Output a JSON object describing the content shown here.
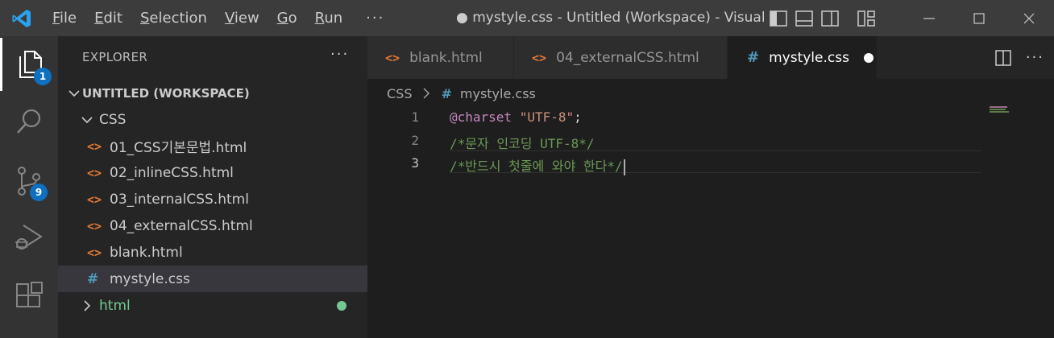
{
  "titlebar": {
    "menu": [
      {
        "label": "File",
        "u": "F",
        "rest": "ile"
      },
      {
        "label": "Edit",
        "u": "E",
        "rest": "dit"
      },
      {
        "label": "Selection",
        "u": "S",
        "rest": "election"
      },
      {
        "label": "View",
        "u": "V",
        "rest": "iew"
      },
      {
        "label": "Go",
        "u": "G",
        "rest": "o"
      },
      {
        "label": "Run",
        "u": "R",
        "rest": "un"
      }
    ],
    "more": "···",
    "title": "● mystyle.css - Untitled (Workspace) - Visual St..."
  },
  "activity": {
    "explorer_badge": "1",
    "scm_badge": "9"
  },
  "sidebar": {
    "header": "EXPLORER",
    "more": "···",
    "workspace": "UNTITLED (WORKSPACE)",
    "folder": "CSS",
    "files": [
      {
        "name": "01_CSS기본문법.html",
        "type": "html",
        "icon": "<>"
      },
      {
        "name": "02_inlineCSS.html",
        "type": "html",
        "icon": "<>"
      },
      {
        "name": "03_internalCSS.html",
        "type": "html",
        "icon": "<>"
      },
      {
        "name": "04_externalCSS.html",
        "type": "html",
        "icon": "<>"
      },
      {
        "name": "blank.html",
        "type": "html",
        "icon": "<>"
      },
      {
        "name": "mystyle.css",
        "type": "css",
        "icon": "#"
      }
    ],
    "subfolder": "html"
  },
  "tabs": [
    {
      "label": "blank.html",
      "icon": "<>"
    },
    {
      "label": "04_externalCSS.html",
      "icon": "<>"
    },
    {
      "label": "mystyle.css",
      "icon": "#",
      "active": true,
      "dirty": true
    }
  ],
  "breadcrumb": {
    "folder": "CSS",
    "file_icon": "#",
    "file": "mystyle.css"
  },
  "editor": {
    "lines": [
      {
        "n": "1",
        "at": "@charset",
        "str": "\"UTF-8\"",
        "end": ";"
      },
      {
        "n": "2",
        "comment": "/*문자 인코딩 UTF-8*/"
      },
      {
        "n": "3",
        "comment": "/*반드시 첫줄에 와야 한다*/"
      }
    ]
  },
  "colors": {
    "accent": "#0e70c0",
    "html_icon": "#e37933",
    "css_icon": "#519aba",
    "git_added": "#73c991"
  }
}
